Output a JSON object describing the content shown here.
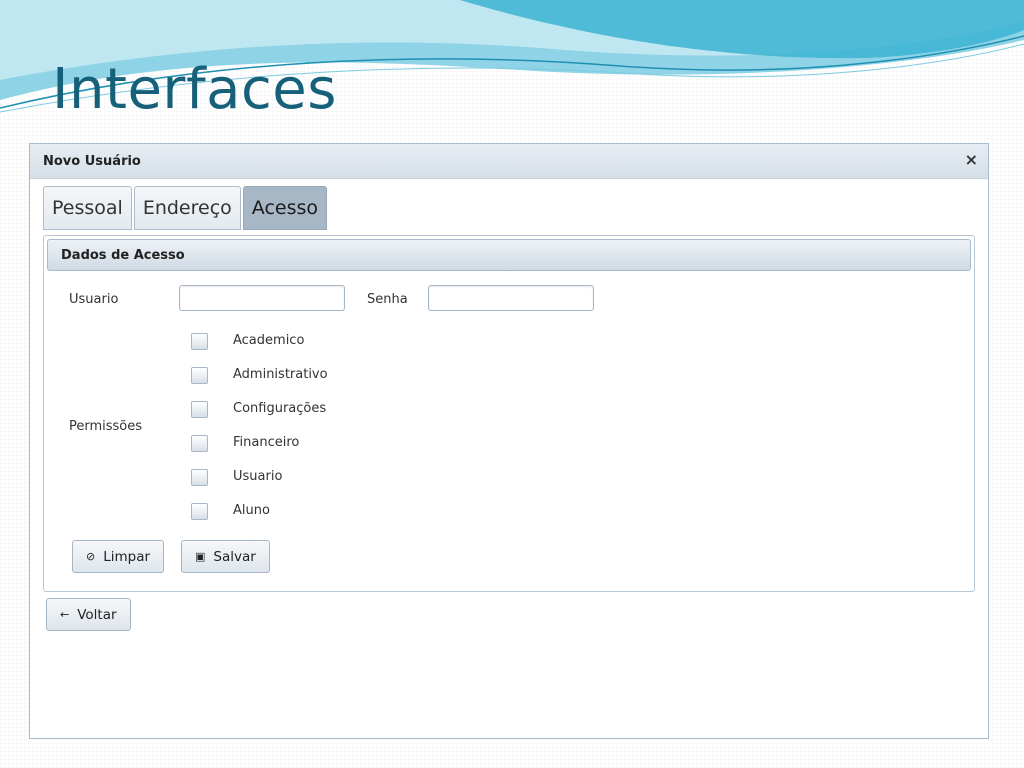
{
  "slide": {
    "title": "Interfaces"
  },
  "dialog": {
    "title": "Novo Usuário",
    "close_icon": "×",
    "tabs": [
      {
        "label": "Pessoal",
        "active": false
      },
      {
        "label": "Endereço",
        "active": false
      },
      {
        "label": "Acesso",
        "active": true
      }
    ],
    "panel": {
      "title": "Dados de Acesso",
      "usuario_label": "Usuario",
      "usuario_value": "",
      "senha_label": "Senha",
      "senha_value": "",
      "permissoes_label": "Permissões",
      "permissoes": [
        {
          "label": "Academico",
          "checked": false
        },
        {
          "label": "Administrativo",
          "checked": false
        },
        {
          "label": "Configurações",
          "checked": false
        },
        {
          "label": "Financeiro",
          "checked": false
        },
        {
          "label": "Usuario",
          "checked": false
        },
        {
          "label": "Aluno",
          "checked": false
        }
      ],
      "limpar_label": "Limpar",
      "limpar_icon": "⊘",
      "salvar_label": "Salvar",
      "salvar_icon": "▣"
    },
    "voltar_label": "Voltar",
    "voltar_icon": "←"
  },
  "colors": {
    "title": "#17607a",
    "active_tab": "#a8b7c6",
    "swoosh_light": "#bfe7f2",
    "swoosh_dark": "#3bb3d2"
  }
}
